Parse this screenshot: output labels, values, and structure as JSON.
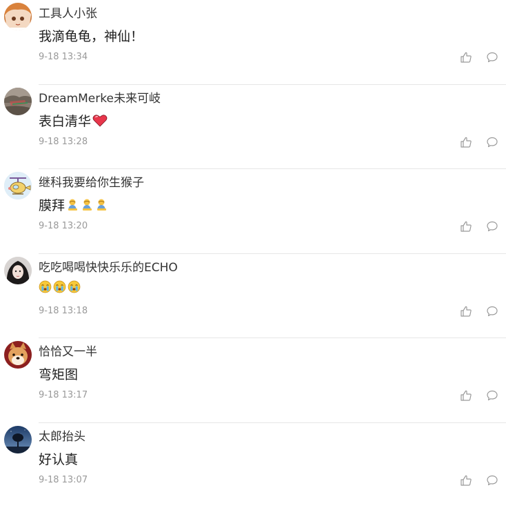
{
  "comments": [
    {
      "username": "工具人小张",
      "text": "我滴龟龟，神仙！",
      "time": "9-18 13:34",
      "avatar_icon": "anime-girl-avatar",
      "emoji": []
    },
    {
      "username": "DreamMerke未来可岐",
      "text": "表白清华",
      "time": "9-18 13:28",
      "avatar_icon": "landscape-avatar",
      "emoji": [
        "red-heart-emoji"
      ]
    },
    {
      "username": "继科我要给你生猴子",
      "text": "膜拜",
      "time": "9-18 13:20",
      "avatar_icon": "cartoon-helicopter-avatar",
      "emoji": [
        "worship-emoji",
        "worship-emoji",
        "worship-emoji"
      ]
    },
    {
      "username": "吃吃喝喝快快乐乐的ECHO",
      "text": "",
      "time": "9-18 13:18",
      "avatar_icon": "portrait-avatar",
      "emoji": [
        "crying-face-emoji",
        "crying-face-emoji",
        "crying-face-emoji"
      ]
    },
    {
      "username": "恰恰又一半",
      "text": "弯矩图",
      "time": "9-18 13:17",
      "avatar_icon": "shiba-dog-avatar",
      "emoji": []
    },
    {
      "username": "太郎抬头",
      "text": "好认真",
      "time": "9-18 13:07",
      "avatar_icon": "night-tree-avatar",
      "emoji": []
    }
  ],
  "colors": {
    "username": "#333333",
    "content": "#222222",
    "timestamp": "#999999",
    "icon": "#999999",
    "divider": "#e6e6e6"
  }
}
